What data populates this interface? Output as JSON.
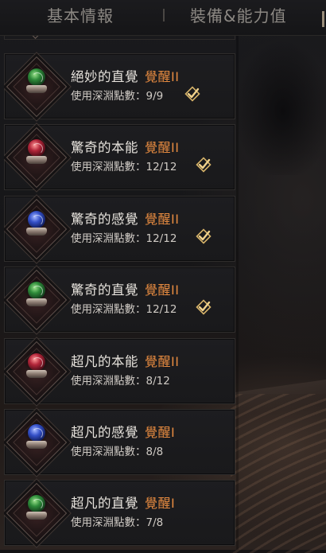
{
  "tabs": {
    "basic_info": "基本情報",
    "gear_ability": "裝備&能力值"
  },
  "colors": {
    "accent_orange": "#e58a40",
    "check_gold": "#d8b46a",
    "text_main": "#e6e2dc",
    "text_sub": "#cfcac4"
  },
  "skills": [
    {
      "name": "絕妙的直覺",
      "awakening": "覺醒II",
      "points_label": "使用深淵點數：9/9",
      "complete": true,
      "orb": "green-orb-icon"
    },
    {
      "name": "驚奇的本能",
      "awakening": "覺醒II",
      "points_label": "使用深淵點數：12/12",
      "complete": true,
      "orb": "red-orb-icon"
    },
    {
      "name": "驚奇的感覺",
      "awakening": "覺醒II",
      "points_label": "使用深淵點數：12/12",
      "complete": true,
      "orb": "blue-orb-icon"
    },
    {
      "name": "驚奇的直覺",
      "awakening": "覺醒II",
      "points_label": "使用深淵點數：12/12",
      "complete": true,
      "orb": "green-orb-icon"
    },
    {
      "name": "超凡的本能",
      "awakening": "覺醒II",
      "points_label": "使用深淵點數：8/12",
      "complete": false,
      "orb": "red-orb-icon"
    },
    {
      "name": "超凡的感覺",
      "awakening": "覺醒I",
      "points_label": "使用深淵點數：8/8",
      "complete": false,
      "orb": "blue-orb-icon"
    },
    {
      "name": "超凡的直覺",
      "awakening": "覺醒I",
      "points_label": "使用深淵點數：7/8",
      "complete": false,
      "orb": "green-orb-icon"
    }
  ]
}
